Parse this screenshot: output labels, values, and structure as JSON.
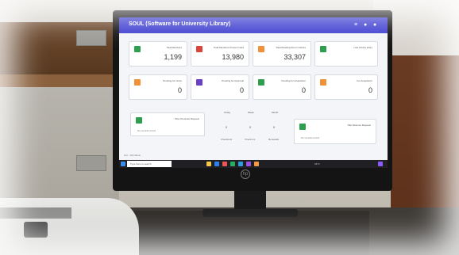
{
  "app": {
    "title": "SOUL (Software for University Library)"
  },
  "cards": [
    {
      "label": "Total Members",
      "value": "1,199",
      "icon_color": "#2e9e4f"
    },
    {
      "label": "Total Members Present Card",
      "value": "13,980",
      "icon_color": "#d9453a"
    },
    {
      "label": "Total Reading Room Visitors",
      "value": "33,307",
      "icon_color": "#f0913a"
    },
    {
      "label": "Last Library Entry",
      "value": "",
      "icon_color": "#2e9e4f"
    },
    {
      "label": "Pending for Circle",
      "value": "0",
      "icon_color": "#f0913a"
    },
    {
      "label": "Pending for Approval",
      "value": "0",
      "icon_color": "#6a3fc7"
    },
    {
      "label": "Pending for Acquisition",
      "value": "0",
      "icon_color": "#2e9e4f"
    },
    {
      "label": "For Acquisition",
      "value": "0",
      "icon_color": "#f0913a"
    }
  ],
  "bottom_cards": [
    {
      "label": "Title Checkout Request",
      "sub": "No records found"
    },
    {
      "label": "Title Reserve Request",
      "sub": "No records found"
    }
  ],
  "middle": {
    "headers": [
      "Today",
      "Week",
      "Month"
    ],
    "values": [
      "0",
      "0",
      "0"
    ],
    "footers": [
      "Checkouts",
      "Check-ins",
      "Renewals"
    ]
  },
  "status_text": "Get - Sub Menu",
  "taskbar": {
    "search_placeholder": "Type here to search",
    "tray": "31°C"
  },
  "colors": {
    "app_bar": "#3f3fd0",
    "screen_bg": "#f4f5f8"
  }
}
